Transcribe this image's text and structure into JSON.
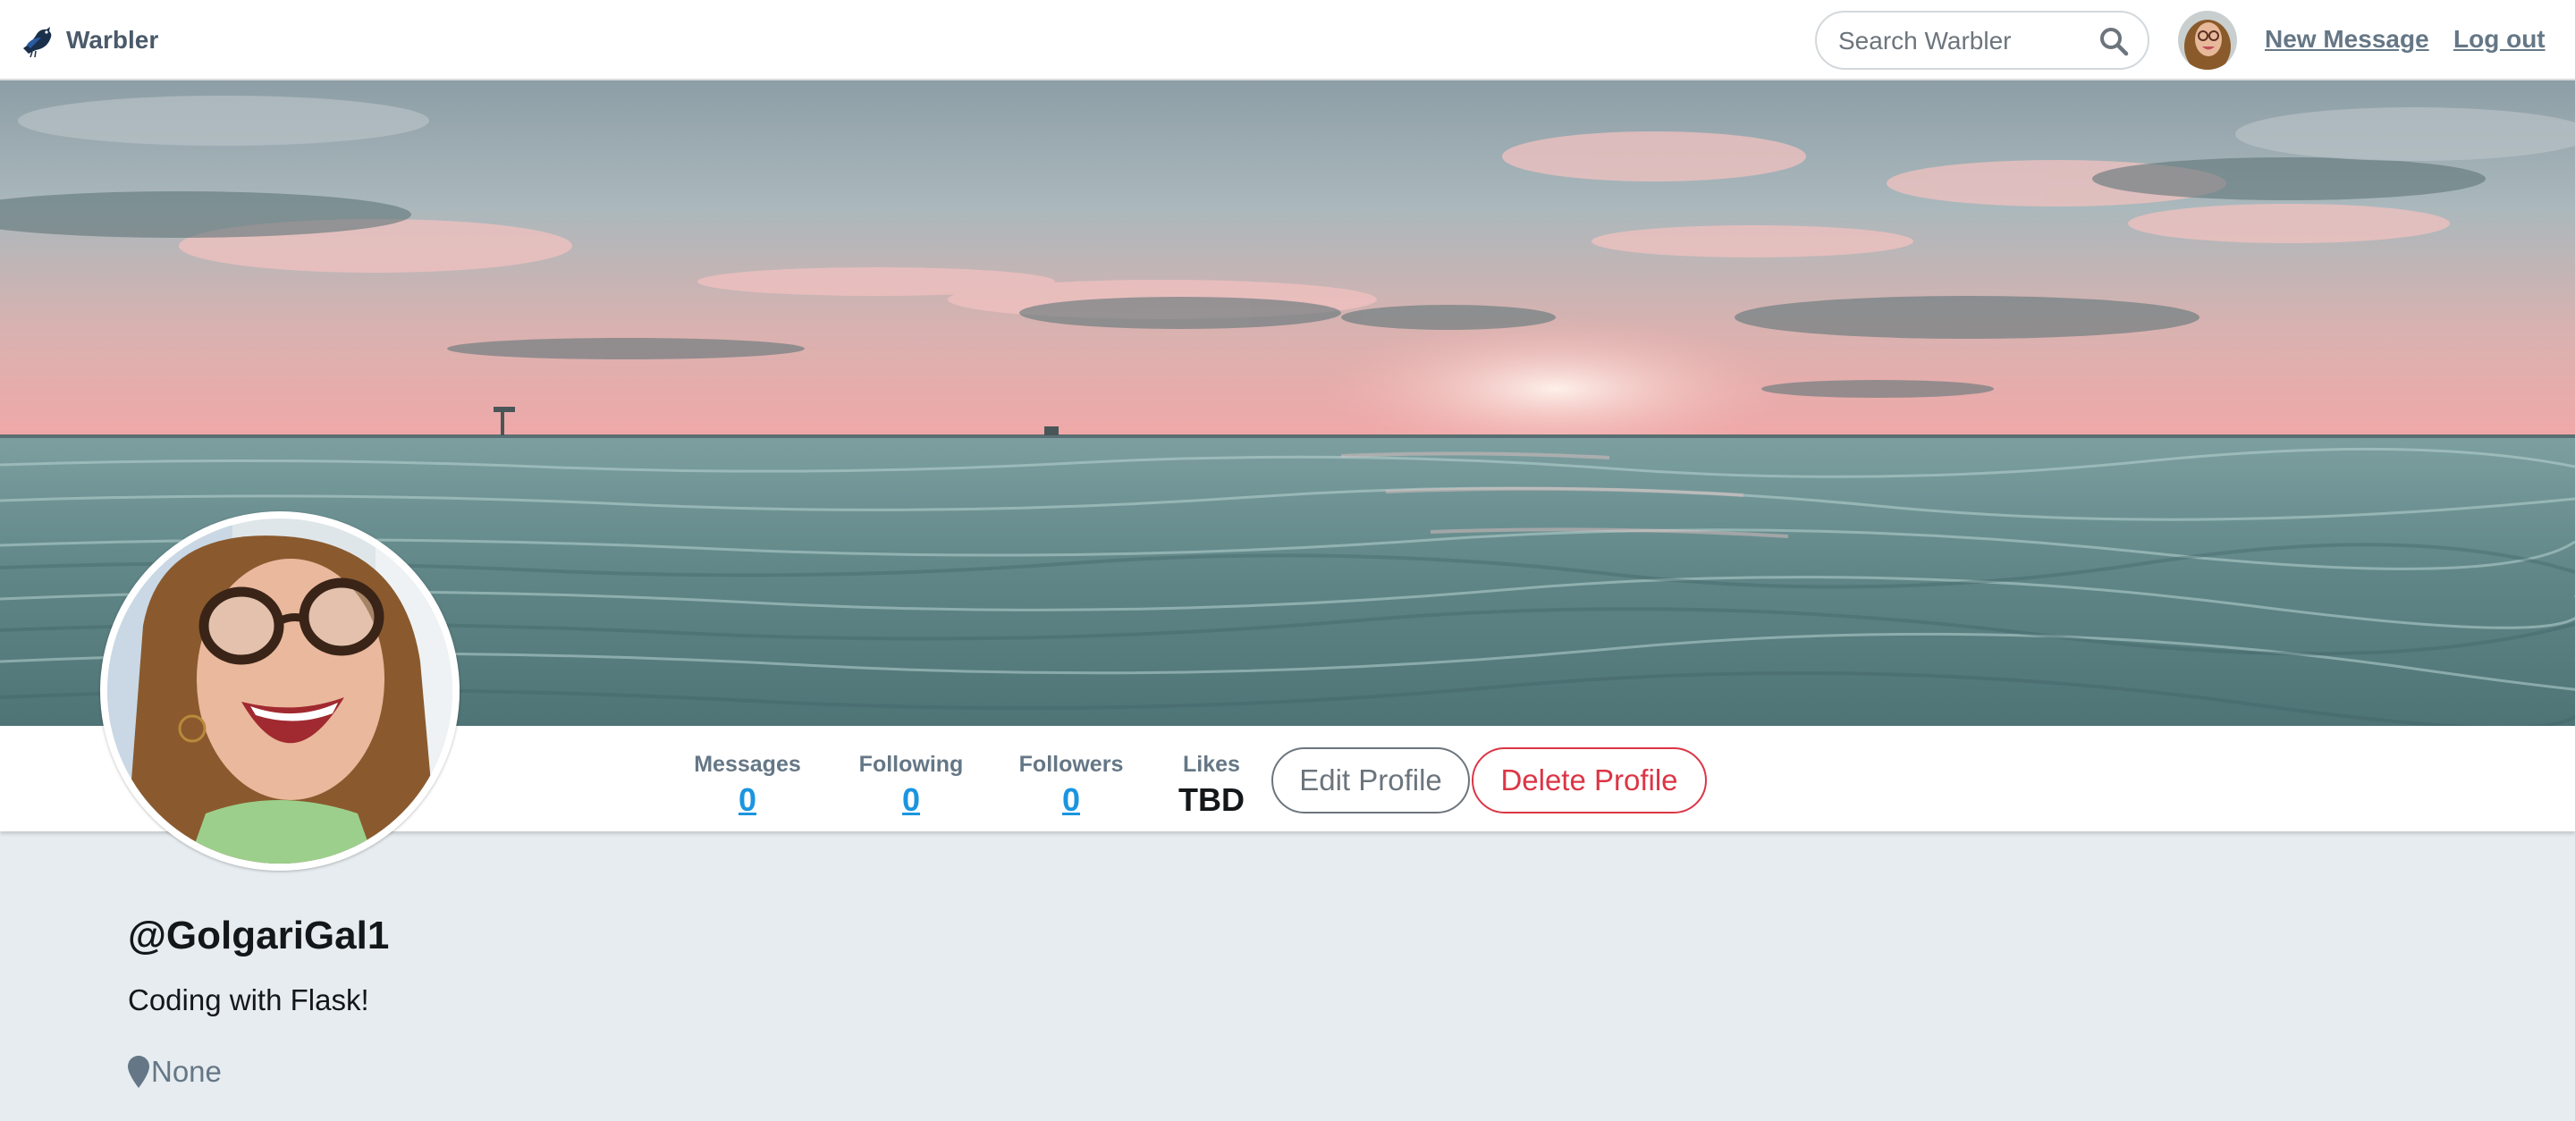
{
  "nav": {
    "brand": "Warbler",
    "search_placeholder": "Search Warbler",
    "new_message": "New Message",
    "logout": "Log out"
  },
  "profile": {
    "username": "@GolgariGal1",
    "bio": "Coding with Flask!",
    "location": "None"
  },
  "stats": [
    {
      "label": "Messages",
      "value": "0"
    },
    {
      "label": "Following",
      "value": "0"
    },
    {
      "label": "Followers",
      "value": "0"
    },
    {
      "label": "Likes",
      "value": "TBD"
    }
  ],
  "actions": {
    "edit": "Edit Profile",
    "delete": "Delete Profile"
  },
  "colors": {
    "link_blue": "#1b95e0",
    "muted": "#657786",
    "danger": "#dc3545",
    "page_bg": "#e6ecf0"
  },
  "icons": [
    "bird-logo-icon",
    "search-icon",
    "map-pin-icon"
  ]
}
